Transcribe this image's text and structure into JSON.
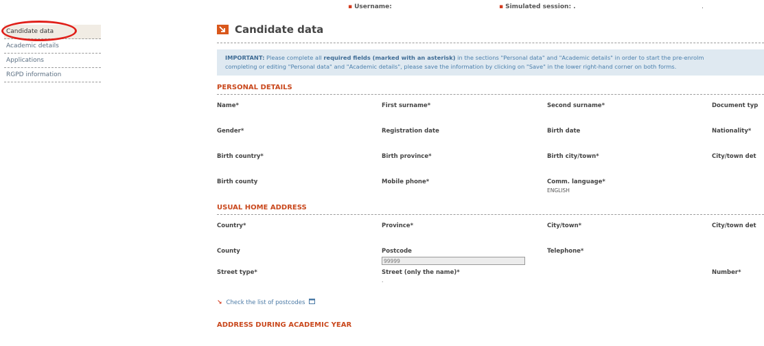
{
  "session": {
    "username_label": "Username:",
    "simulated_label": "Simulated session: .",
    "dot": "."
  },
  "sidebar": {
    "items": [
      {
        "label": "Candidate data"
      },
      {
        "label": "Academic details"
      },
      {
        "label": "Applications"
      },
      {
        "label": "RGPD information"
      }
    ]
  },
  "page": {
    "title": "Candidate data",
    "notice_line1_a": "IMPORTANT:",
    "notice_line1_b": " Please complete all ",
    "notice_line1_c": "required fields (marked with an asterisk)",
    "notice_line1_d": " in the sections \"Personal data\" and \"Academic details\" in order to start the pre-enrolm",
    "notice_line2": "completing or editing \"Personal data\" and \"Academic details\", please save the information by clicking on \"Save\" in the lower right-hand corner on both forms."
  },
  "personal": {
    "title": "PERSONAL DETAILS",
    "name": "Name*",
    "first_surname": "First surname*",
    "second_surname": "Second surname*",
    "document_type": "Document typ",
    "gender": "Gender*",
    "registration_date": "Registration date",
    "birth_date": "Birth date",
    "nationality": "Nationality*",
    "birth_country": "Birth country*",
    "birth_province": "Birth province*",
    "birth_city": "Birth city/town*",
    "city_town_details": "City/town det",
    "birth_county": "Birth county",
    "mobile_phone": "Mobile phone*",
    "comm_language": "Comm. language*",
    "comm_language_value": "ENGLISH"
  },
  "home_address": {
    "title": "USUAL HOME ADDRESS",
    "country": "Country*",
    "province": "Province*",
    "city_town": "City/town*",
    "city_town_details": "City/town det",
    "county": "County",
    "postcode": "Postcode",
    "postcode_placeholder": "99999",
    "telephone": "Telephone*",
    "street_type": "Street type*",
    "street_name": "Street (only the name)*",
    "street_value": ".",
    "number": "Number*",
    "postcodes_link": "Check the list of postcodes"
  },
  "academic_address": {
    "title": "ADDRESS DURING ACADEMIC YEAR"
  },
  "colors": {
    "accent": "#c9481d",
    "annotation": "#e0201a",
    "notice_bg": "#dfe9f1"
  }
}
